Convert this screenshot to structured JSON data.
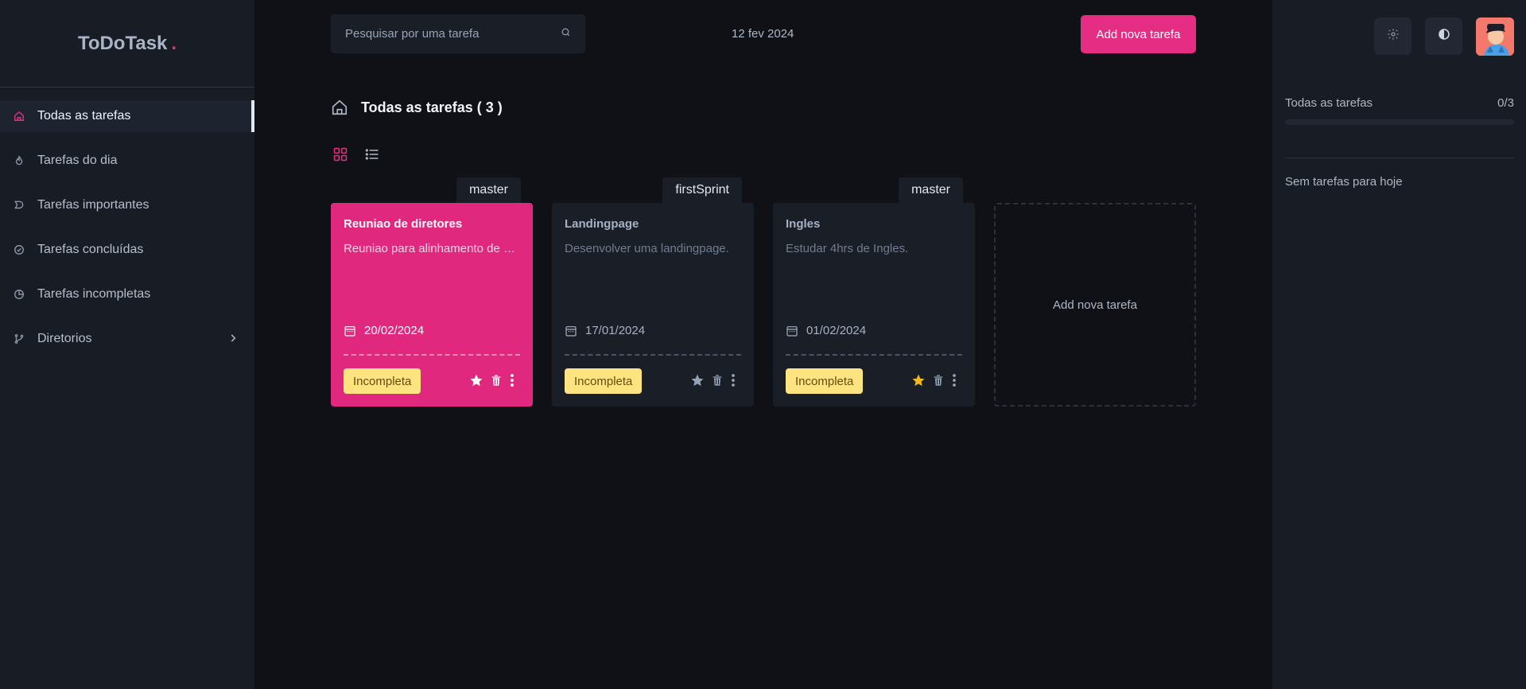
{
  "app": {
    "name": "ToDoTask",
    "dot": "."
  },
  "sidebar": {
    "items": [
      {
        "label": "Todas as tarefas",
        "icon": "home-icon",
        "active": true
      },
      {
        "label": "Tarefas do dia",
        "icon": "sun-icon"
      },
      {
        "label": "Tarefas importantes",
        "icon": "bookmark-icon"
      },
      {
        "label": "Tarefas concluídas",
        "icon": "check-circle-icon"
      },
      {
        "label": "Tarefas incompletas",
        "icon": "partial-circle-icon"
      },
      {
        "label": "Diretorios",
        "icon": "branch-icon"
      }
    ]
  },
  "header": {
    "search_placeholder": "Pesquisar por uma tarefa",
    "date": "12 fev 2024",
    "add_button": "Add nova tarefa"
  },
  "main": {
    "title": "Todas as tarefas ( 3 )",
    "view": "grid"
  },
  "tasks": [
    {
      "tag": "master",
      "title": "Reuniao de diretores",
      "description": "Reuniao para alinhamento de metas",
      "date": "20/02/2024",
      "status": "Incompleta",
      "important": false,
      "highlight": true
    },
    {
      "tag": "firstSprint",
      "title": "Landingpage",
      "description": "Desenvolver uma landingpage.",
      "date": "17/01/2024",
      "status": "Incompleta",
      "important": false,
      "highlight": false
    },
    {
      "tag": "master",
      "title": "Ingles",
      "description": "Estudar 4hrs de Ingles.",
      "date": "01/02/2024",
      "status": "Incompleta",
      "important": true,
      "highlight": false
    }
  ],
  "add_card": {
    "label": "Add nova tarefa"
  },
  "right_panel": {
    "progress_label": "Todas as tarefas",
    "progress_count": "0/3",
    "progress_fraction": 0,
    "empty_today": "Sem tarefas para hoje"
  },
  "colors": {
    "accent": "#e62d84",
    "status_bg": "#fde480",
    "star_active": "#f0b91b"
  }
}
